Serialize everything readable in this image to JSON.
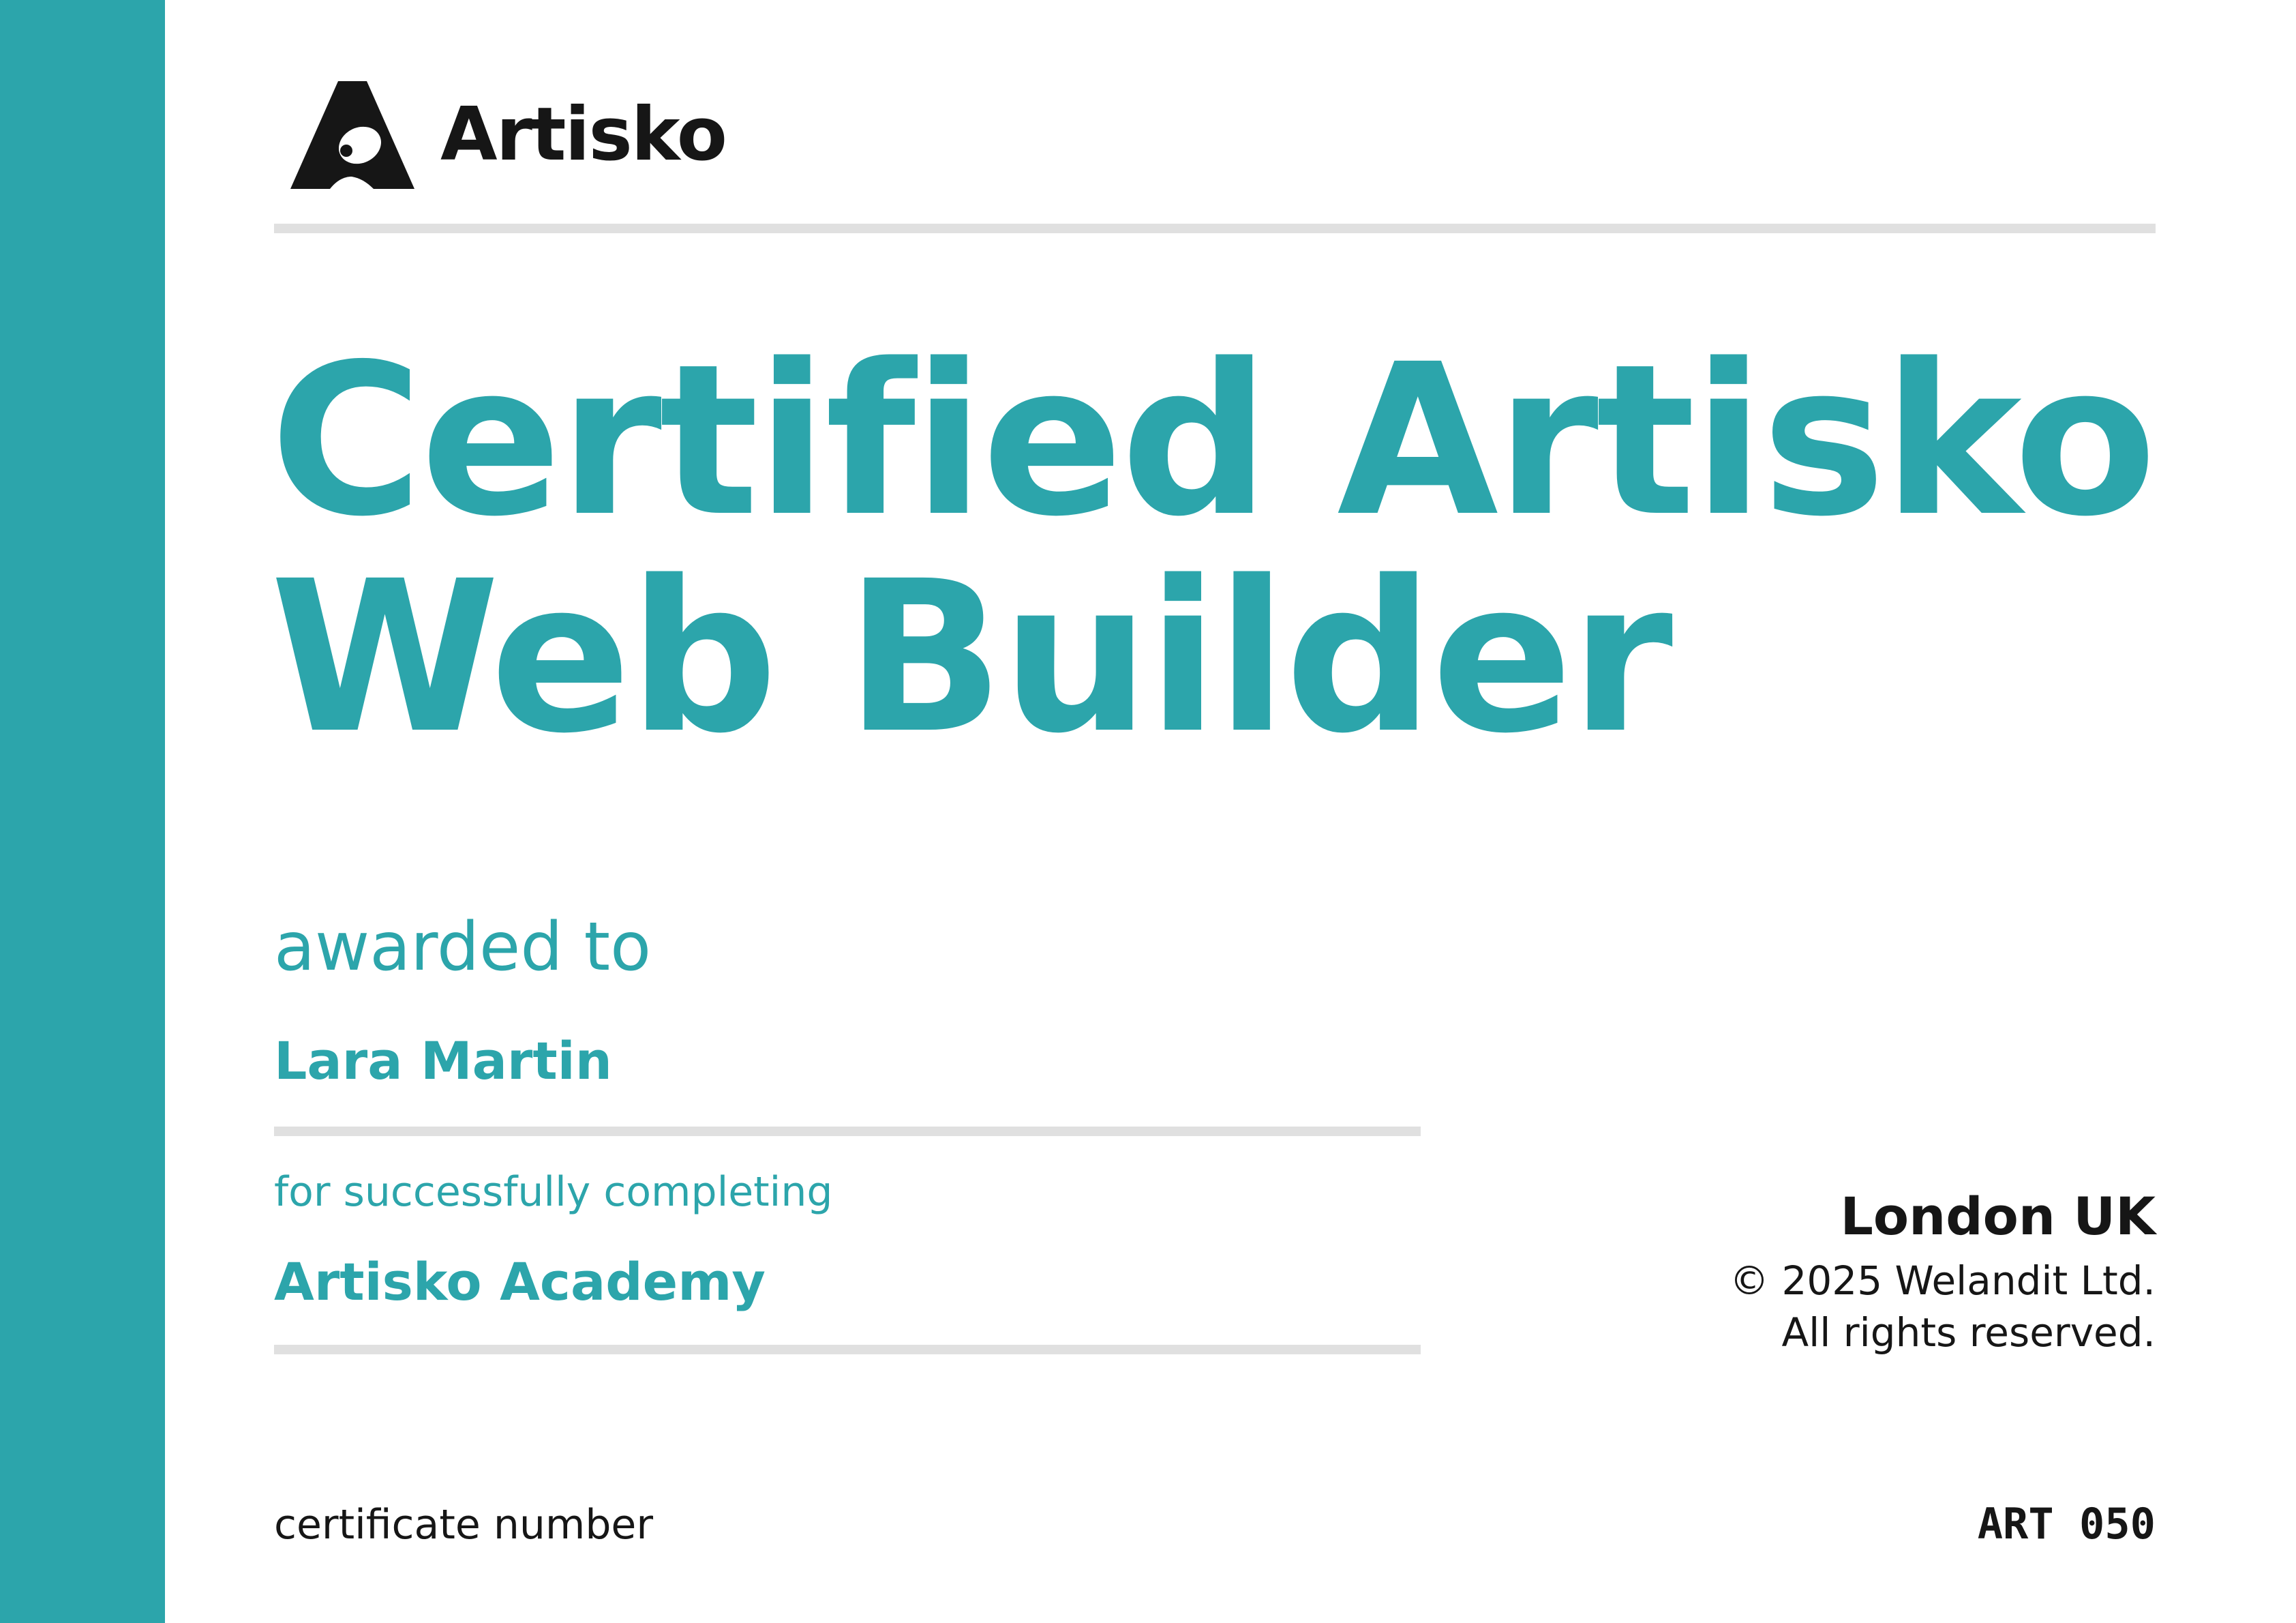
{
  "brand": {
    "name": "Artisko",
    "logo_icon": "artisko-a-mark-icon",
    "accent_color": "#2ca5ab",
    "text_color": "#161616"
  },
  "certificate": {
    "title_line_1": "Certified Artisko",
    "title_line_2": "Web Builder",
    "awarded_label": "awarded to",
    "recipient_name": "Lara Martin",
    "completing_label": "for successfully completing",
    "course_name": "Artisko Academy",
    "location": "London UK",
    "copyright_line_1": "© 2025 Welandit Ltd.",
    "copyright_line_2": "All rights reserved.",
    "number_label": "certificate number",
    "number_value": "ART 050"
  }
}
